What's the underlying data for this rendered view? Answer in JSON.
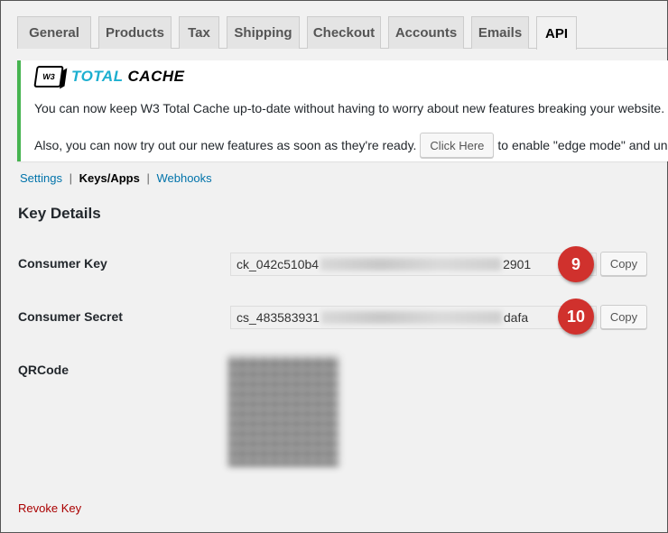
{
  "tabs": [
    {
      "label": "General"
    },
    {
      "label": "Products"
    },
    {
      "label": "Tax"
    },
    {
      "label": "Shipping"
    },
    {
      "label": "Checkout"
    },
    {
      "label": "Accounts"
    },
    {
      "label": "Emails"
    },
    {
      "label": "API"
    }
  ],
  "notice": {
    "logo_w3": "W3",
    "logo_total": "TOTAL",
    "logo_cache": "CACHE",
    "line1": "You can now keep W3 Total Cache up-to-date without having to worry about new features breaking your website. Th",
    "line2_before": "Also, you can now try out our new features as soon as they're ready.",
    "button": "Click Here",
    "line2_after": "to enable \"edge mode\" and unloc"
  },
  "subnav": {
    "settings": "Settings",
    "sep": "|",
    "keys_apps": "Keys/Apps",
    "webhooks": "Webhooks"
  },
  "heading": "Key Details",
  "consumer_key": {
    "label": "Consumer Key",
    "prefix": "ck_042c510b4",
    "suffix": "2901",
    "badge": "9",
    "copy": "Copy"
  },
  "consumer_secret": {
    "label": "Consumer Secret",
    "prefix": "cs_483583931",
    "suffix": "dafa",
    "badge": "10",
    "copy": "Copy"
  },
  "qrcode_label": "QRCode",
  "revoke": "Revoke Key",
  "colors": {
    "accent_green": "#46b450",
    "link_blue": "#0073aa",
    "badge_red": "#d0312d",
    "revoke_red": "#aa0000",
    "logo_teal": "#1dafd0"
  }
}
